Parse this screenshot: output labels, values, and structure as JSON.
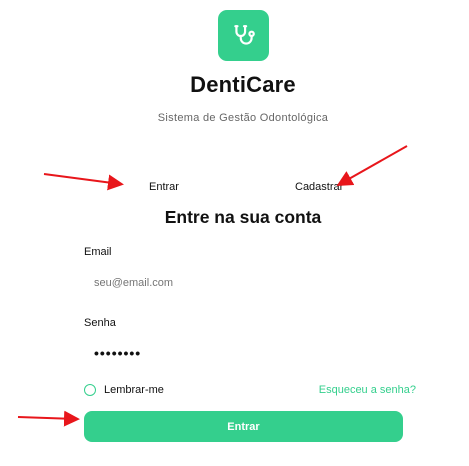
{
  "app": {
    "name": "DentiCare",
    "subtitle": "Sistema de Gestão Odontológica",
    "brand_color": "#34cf8d",
    "logo_icon": "stethoscope-icon"
  },
  "tabs": {
    "login": "Entrar",
    "register": "Cadastrar"
  },
  "form": {
    "title": "Entre na sua conta",
    "email_label": "Email",
    "email_placeholder": "seu@email.com",
    "password_label": "Senha",
    "password_value": "••••••••",
    "remember_label": "Lembrar-me",
    "remember_checked": false,
    "forgot_link": "Esqueceu a senha?",
    "submit_label": "Entrar"
  },
  "annotation": {
    "arrow_color": "#e8161b"
  }
}
